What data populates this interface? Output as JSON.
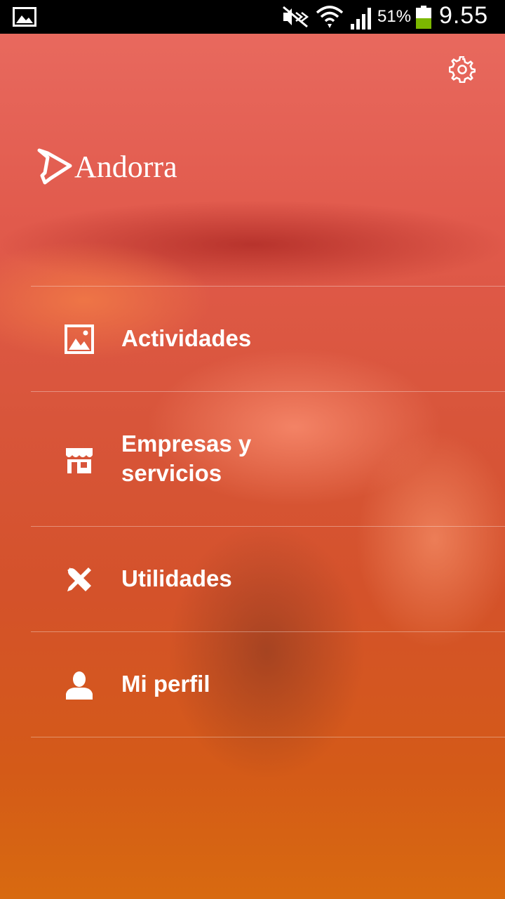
{
  "status_bar": {
    "battery_percent": "51%",
    "time": "9.55",
    "icons": [
      "gallery-icon",
      "mute-icon",
      "wifi-icon",
      "signal-icon",
      "battery-icon"
    ],
    "battery_color": "#7cb800"
  },
  "header": {
    "settings_icon": "gear-icon",
    "logo_text": "Andorra"
  },
  "menu": {
    "items": [
      {
        "label": "Actividades",
        "icon": "image-icon"
      },
      {
        "label": "Empresas y\nservicios",
        "icon": "store-icon"
      },
      {
        "label": "Utilidades",
        "icon": "tools-icon"
      },
      {
        "label": "Mi perfil",
        "icon": "user-icon"
      }
    ]
  },
  "colors": {
    "overlay_top": "#e8695e",
    "overlay_bottom": "#d86a10",
    "text": "#ffffff"
  }
}
